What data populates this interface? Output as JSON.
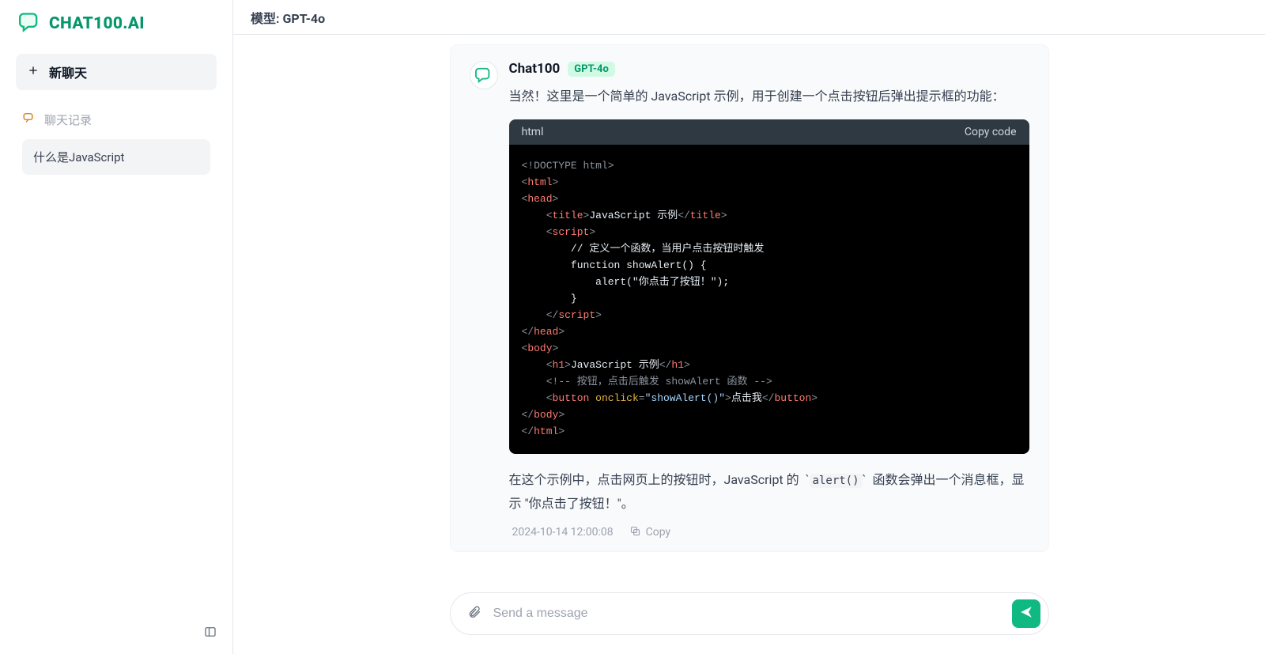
{
  "brand": {
    "name": "CHAT100.AI"
  },
  "sidebar": {
    "new_chat_label": "新聊天",
    "history_label": "聊天记录",
    "items": [
      {
        "label": "什么是JavaScript"
      }
    ]
  },
  "topbar": {
    "model_label": "模型: GPT-4o"
  },
  "message": {
    "author": "Chat100",
    "badge": "GPT-4o",
    "intro": "当然！这里是一个简单的 JavaScript 示例，用于创建一个点击按钮后弹出提示框的功能：",
    "code_lang": "html",
    "copy_code_label": "Copy code",
    "code": {
      "doctype": "<!DOCTYPE html>",
      "title_text": "JavaScript 示例",
      "comment1": "// 定义一个函数，当用户点击按钮时触发",
      "fn_decl": "function showAlert() {",
      "alert_call": "alert(\"你点击了按钮！\");",
      "h1_text": "JavaScript 示例",
      "btn_comment": "<!-- 按钮，点击后触发 showAlert 函数 -->",
      "onclick_val": "showAlert()",
      "btn_text": "点击我"
    },
    "after_code_1": "在这个示例中，点击网页上的按钮时，JavaScript 的",
    "after_code_inline": "alert()",
    "after_code_2": "函数会弹出一个消息框，显示 \"你点击了按钮！\"。",
    "timestamp": "2024-10-14 12:00:08",
    "copy_label": "Copy"
  },
  "composer": {
    "placeholder": "Send a message"
  }
}
